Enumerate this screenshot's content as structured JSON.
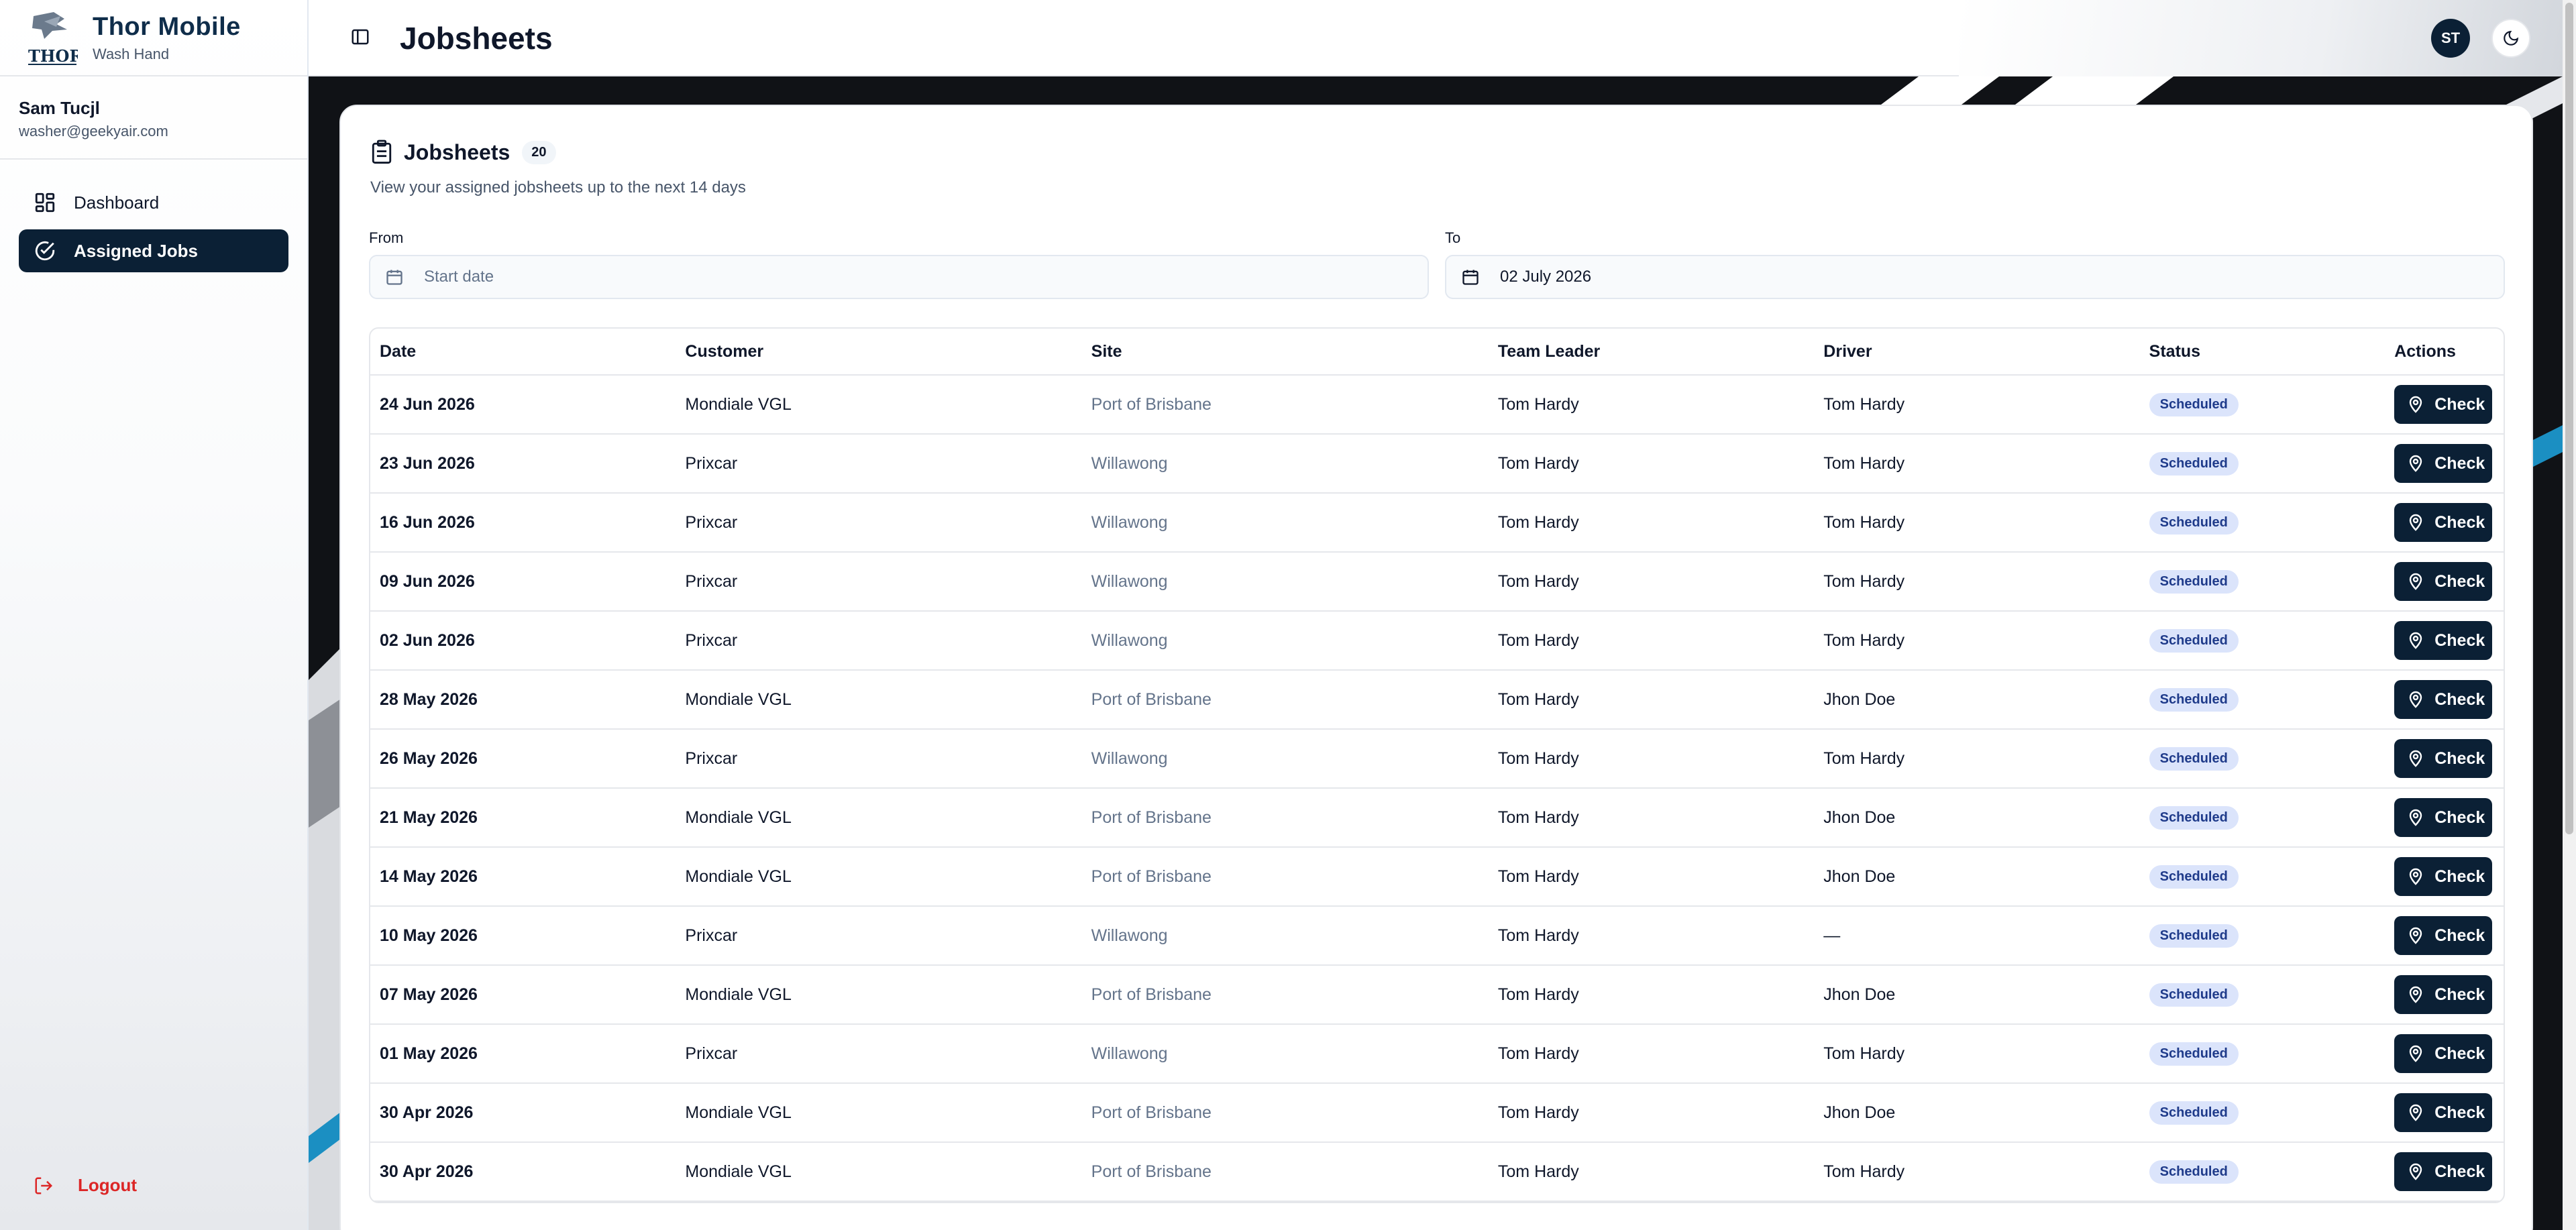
{
  "brand": {
    "title": "Thor Mobile",
    "subtitle": "Wash Hand",
    "logo_text": "THOR"
  },
  "user": {
    "name": "Sam Tucjl",
    "email": "washer@geekyair.com"
  },
  "nav": {
    "items": [
      {
        "label": "Dashboard",
        "icon": "dashboard-icon"
      },
      {
        "label": "Assigned Jobs",
        "icon": "check-circle-icon"
      }
    ]
  },
  "logout_label": "Logout",
  "header": {
    "title": "Jobsheets",
    "avatar_initials": "ST"
  },
  "card": {
    "title": "Jobsheets",
    "count": "20",
    "subtitle": "View your assigned jobsheets up to the next 14 days",
    "from_label": "From",
    "from_placeholder": "Start date",
    "to_label": "To",
    "to_value": "02 July 2026"
  },
  "table": {
    "columns": [
      "Date",
      "Customer",
      "Site",
      "Team Leader",
      "Driver",
      "Status",
      "Actions"
    ],
    "action_label": "Check",
    "rows": [
      {
        "date": "24 Jun 2026",
        "customer": "Mondiale VGL",
        "site": "Port of Brisbane",
        "team_leader": "Tom Hardy",
        "driver": "Tom Hardy",
        "status": "Scheduled"
      },
      {
        "date": "23 Jun 2026",
        "customer": "Prixcar",
        "site": "Willawong",
        "team_leader": "Tom Hardy",
        "driver": "Tom Hardy",
        "status": "Scheduled"
      },
      {
        "date": "16 Jun 2026",
        "customer": "Prixcar",
        "site": "Willawong",
        "team_leader": "Tom Hardy",
        "driver": "Tom Hardy",
        "status": "Scheduled"
      },
      {
        "date": "09 Jun 2026",
        "customer": "Prixcar",
        "site": "Willawong",
        "team_leader": "Tom Hardy",
        "driver": "Tom Hardy",
        "status": "Scheduled"
      },
      {
        "date": "02 Jun 2026",
        "customer": "Prixcar",
        "site": "Willawong",
        "team_leader": "Tom Hardy",
        "driver": "Tom Hardy",
        "status": "Scheduled"
      },
      {
        "date": "28 May 2026",
        "customer": "Mondiale VGL",
        "site": "Port of Brisbane",
        "team_leader": "Tom Hardy",
        "driver": "Jhon Doe",
        "status": "Scheduled"
      },
      {
        "date": "26 May 2026",
        "customer": "Prixcar",
        "site": "Willawong",
        "team_leader": "Tom Hardy",
        "driver": "Tom Hardy",
        "status": "Scheduled"
      },
      {
        "date": "21 May 2026",
        "customer": "Mondiale VGL",
        "site": "Port of Brisbane",
        "team_leader": "Tom Hardy",
        "driver": "Jhon Doe",
        "status": "Scheduled"
      },
      {
        "date": "14 May 2026",
        "customer": "Mondiale VGL",
        "site": "Port of Brisbane",
        "team_leader": "Tom Hardy",
        "driver": "Jhon Doe",
        "status": "Scheduled"
      },
      {
        "date": "10 May 2026",
        "customer": "Prixcar",
        "site": "Willawong",
        "team_leader": "Tom Hardy",
        "driver": "—",
        "status": "Scheduled"
      },
      {
        "date": "07 May 2026",
        "customer": "Mondiale VGL",
        "site": "Port of Brisbane",
        "team_leader": "Tom Hardy",
        "driver": "Jhon Doe",
        "status": "Scheduled"
      },
      {
        "date": "01 May 2026",
        "customer": "Prixcar",
        "site": "Willawong",
        "team_leader": "Tom Hardy",
        "driver": "Tom Hardy",
        "status": "Scheduled"
      },
      {
        "date": "30 Apr 2026",
        "customer": "Mondiale VGL",
        "site": "Port of Brisbane",
        "team_leader": "Tom Hardy",
        "driver": "Jhon Doe",
        "status": "Scheduled"
      },
      {
        "date": "30 Apr 2026",
        "customer": "Mondiale VGL",
        "site": "Port of Brisbane",
        "team_leader": "Tom Hardy",
        "driver": "Tom Hardy",
        "status": "Scheduled"
      }
    ]
  },
  "colors": {
    "primary": "#0b2035",
    "badge_bg": "#dbe4fb",
    "badge_text": "#1e3a8a",
    "logout": "#dc2626"
  }
}
